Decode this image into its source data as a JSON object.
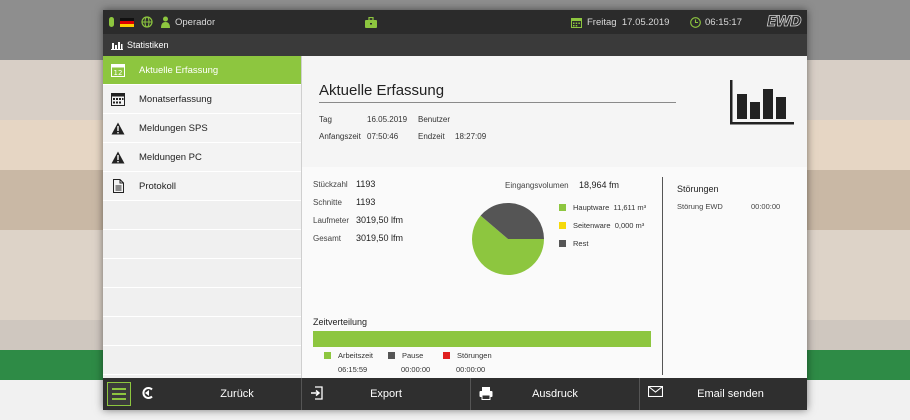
{
  "topbar": {
    "operator": "Operador",
    "day": "Freitag",
    "date": "17.05.2019",
    "time": "06:15:17",
    "logo": "EWD"
  },
  "section": {
    "title": "Statistiken"
  },
  "sidebar": {
    "items": [
      {
        "label": "Aktuelle Erfassung",
        "icon": "calendar-day-icon",
        "active": true
      },
      {
        "label": "Monatserfassung",
        "icon": "calendar-month-icon"
      },
      {
        "label": "Meldungen SPS",
        "icon": "warning-icon"
      },
      {
        "label": "Meldungen PC",
        "icon": "warning-icon"
      },
      {
        "label": "Protokoll",
        "icon": "document-icon"
      }
    ],
    "calendar_icon_text": "12"
  },
  "main": {
    "title": "Aktuelle Erfassung",
    "tag_label": "Tag",
    "tag_value": "16.05.2019",
    "benutzer_label": "Benutzer",
    "anfang_label": "Anfangszeit",
    "anfang_value": "07:50:46",
    "ende_label": "Endzeit",
    "ende_value": "18:27:09",
    "stats": [
      {
        "label": "Stückzahl",
        "value": "1193"
      },
      {
        "label": "Schnitte",
        "value": "1193"
      },
      {
        "label": "Laufmeter",
        "value": "3019,50 lfm"
      },
      {
        "label": "Gesamt",
        "value": "3019,50 lfm"
      }
    ],
    "eingangsvolumen_label": "Eingangsvolumen",
    "eingangsvolumen_value": "18,964 fm",
    "pie_legend": [
      {
        "label": "Hauptware",
        "value": "11,611 m³",
        "color": "#8dc63f"
      },
      {
        "label": "Seitenware",
        "value": "0,000 m³",
        "color": "#f5d90a"
      },
      {
        "label": "Rest",
        "value": "",
        "color": "#555555"
      }
    ],
    "stoerungen": {
      "title": "Störungen",
      "rows": [
        {
          "label": "Störung EWD",
          "value": "00:00:00"
        }
      ]
    },
    "zeitverteilung": {
      "title": "Zeitverteilung",
      "legend": [
        {
          "label": "Arbeitszeit",
          "value": "06:15:59",
          "color": "#8dc63f"
        },
        {
          "label": "Pause",
          "value": "00:00:00",
          "color": "#555555"
        },
        {
          "label": "Störungen",
          "value": "00:00:00",
          "color": "#e02020"
        }
      ]
    }
  },
  "chart_data": {
    "type": "pie",
    "categories": [
      "Hauptware",
      "Seitenware",
      "Rest"
    ],
    "values": [
      11.611,
      0.0,
      7.353
    ],
    "colors": [
      "#8dc63f",
      "#f5d90a",
      "#555555"
    ]
  },
  "bottombar": {
    "back": "Zurück",
    "export": "Export",
    "print": "Ausdruck",
    "email": "Email senden"
  }
}
